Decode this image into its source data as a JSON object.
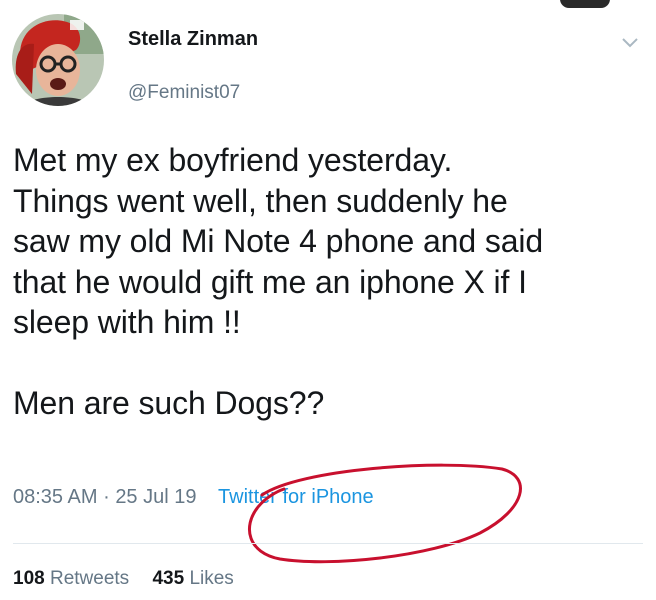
{
  "user": {
    "name": "Stella Zinman",
    "handle": "@Feminist07"
  },
  "tweet": {
    "lines": [
      "Met my ex boyfriend yesterday.",
      "Things went well, then suddenly he",
      "saw my old Mi Note 4 phone and said",
      "that he would gift me an iphone X if I",
      "sleep with him !!"
    ],
    "closing_line": "Men are such Dogs??"
  },
  "meta": {
    "time": "08:35 AM",
    "separator": "·",
    "date": "25 Jul 19",
    "source": "Twitter for iPhone"
  },
  "stats": {
    "retweets_count": "108",
    "retweets_label": "Retweets",
    "likes_count": "435",
    "likes_label": "Likes"
  },
  "icons": {
    "menu": "chevron-down-icon"
  },
  "colors": {
    "link": "#1b95e0",
    "secondary_text": "#657786",
    "annotation_circle": "#c8102e"
  }
}
